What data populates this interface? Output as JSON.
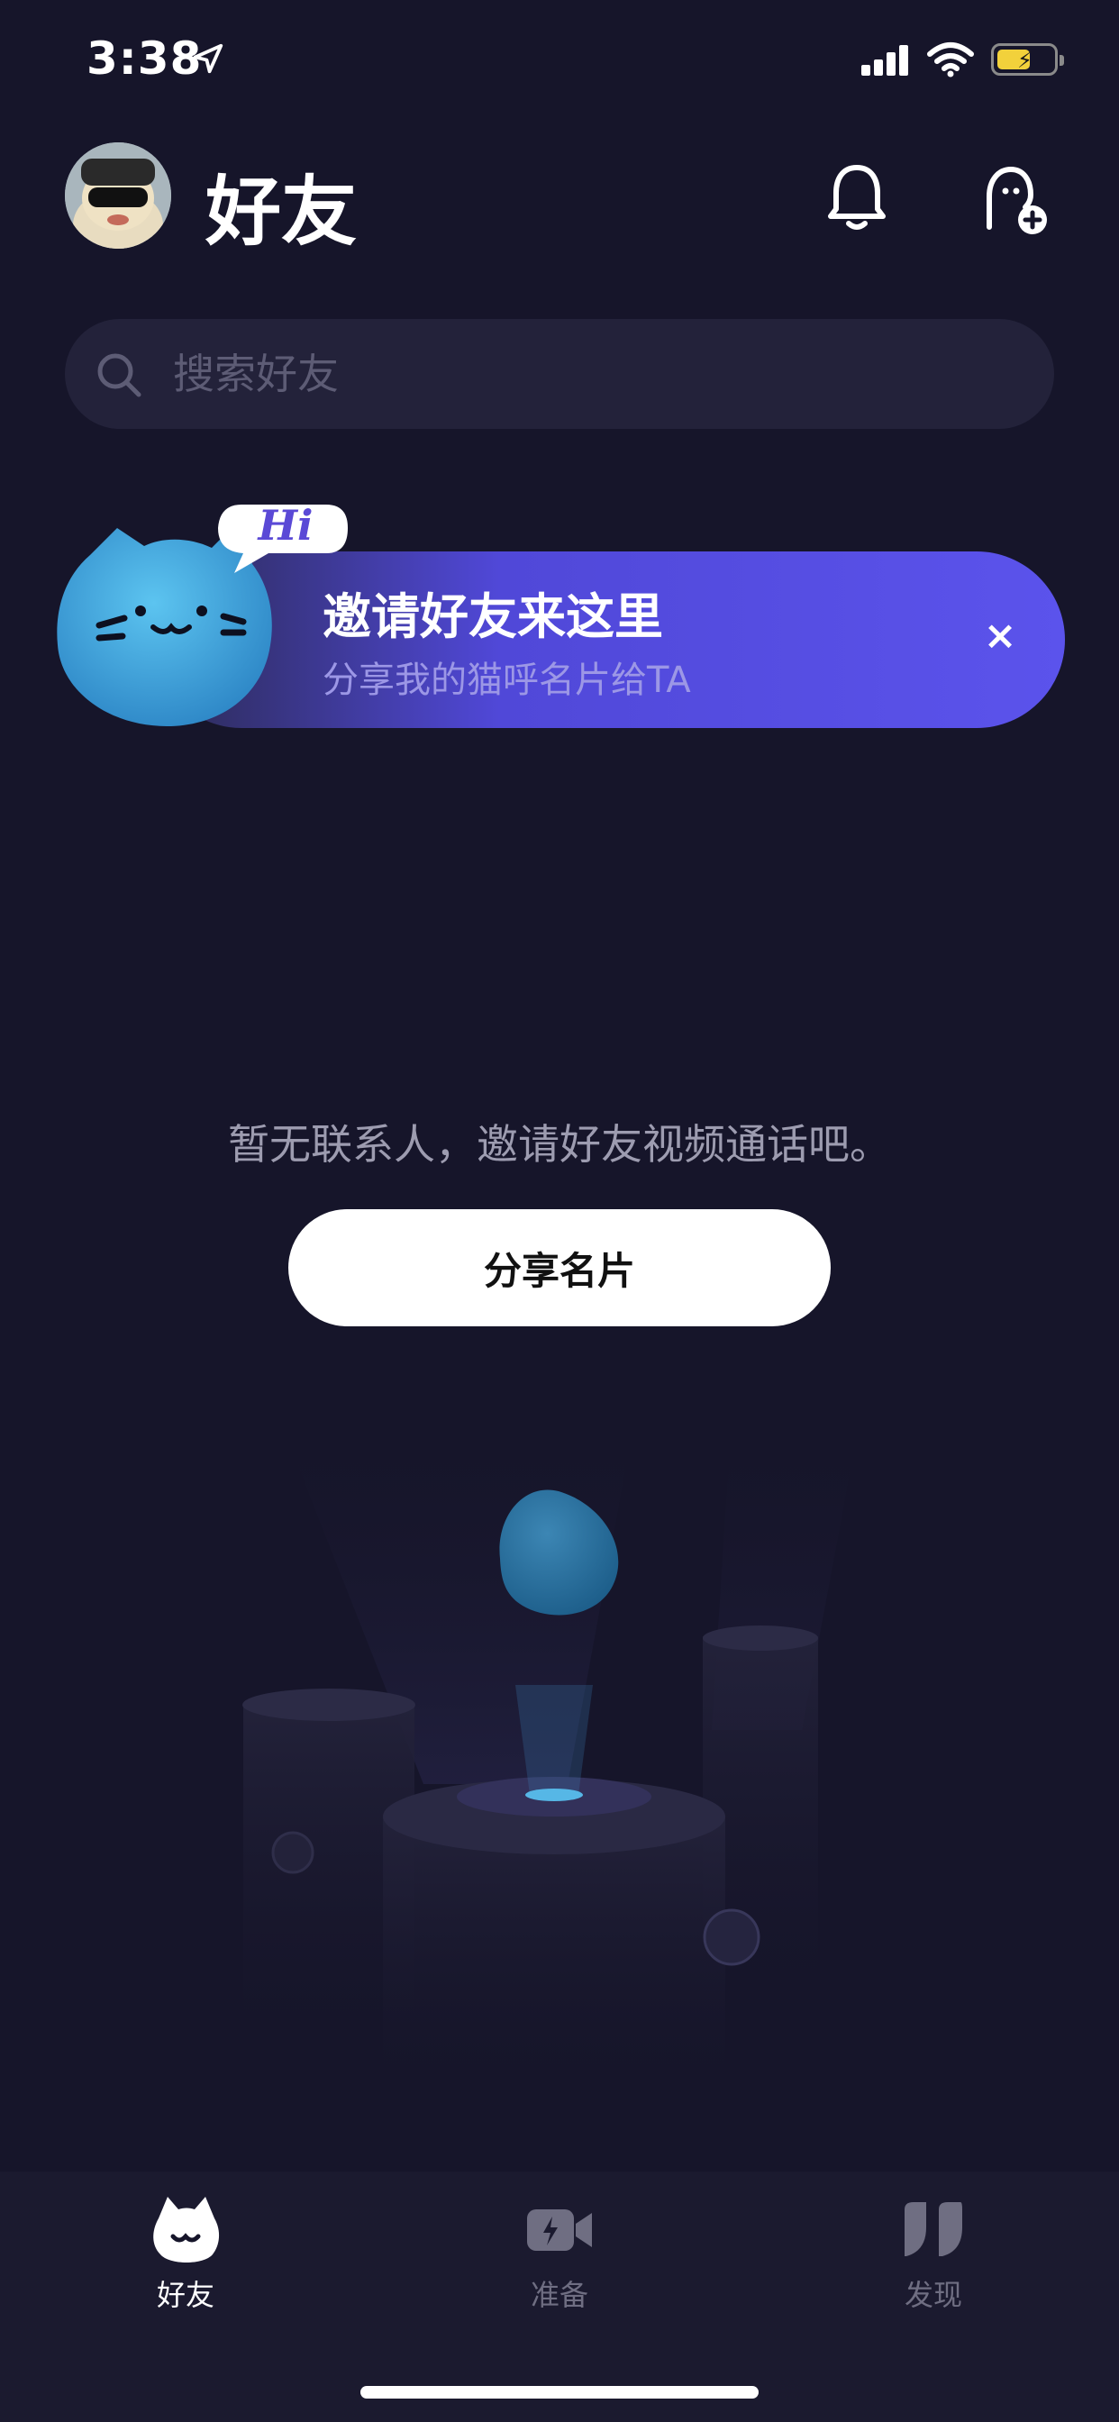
{
  "status_bar": {
    "time": "3:38"
  },
  "header": {
    "title": "好友"
  },
  "search": {
    "placeholder": "搜索好友"
  },
  "invite_banner": {
    "bubble_text": "Hi",
    "title": "邀请好友来这里",
    "subtitle": "分享我的猫呼名片给TA",
    "close_symbol": "×"
  },
  "empty_state": {
    "message": "暂无联系人，邀请好友视频通话吧。",
    "button_label": "分享名片"
  },
  "tab_bar": {
    "tabs": [
      {
        "label": "好友",
        "icon": "cat-face-icon",
        "active": true
      },
      {
        "label": "准备",
        "icon": "video-camera-icon",
        "active": false
      },
      {
        "label": "发现",
        "icon": "quote-icon",
        "active": false
      }
    ]
  },
  "colors": {
    "accent": "#5b53ec",
    "background": "#16152a",
    "tab_active": "#ffffff",
    "tab_inactive": "#6f6e82"
  }
}
